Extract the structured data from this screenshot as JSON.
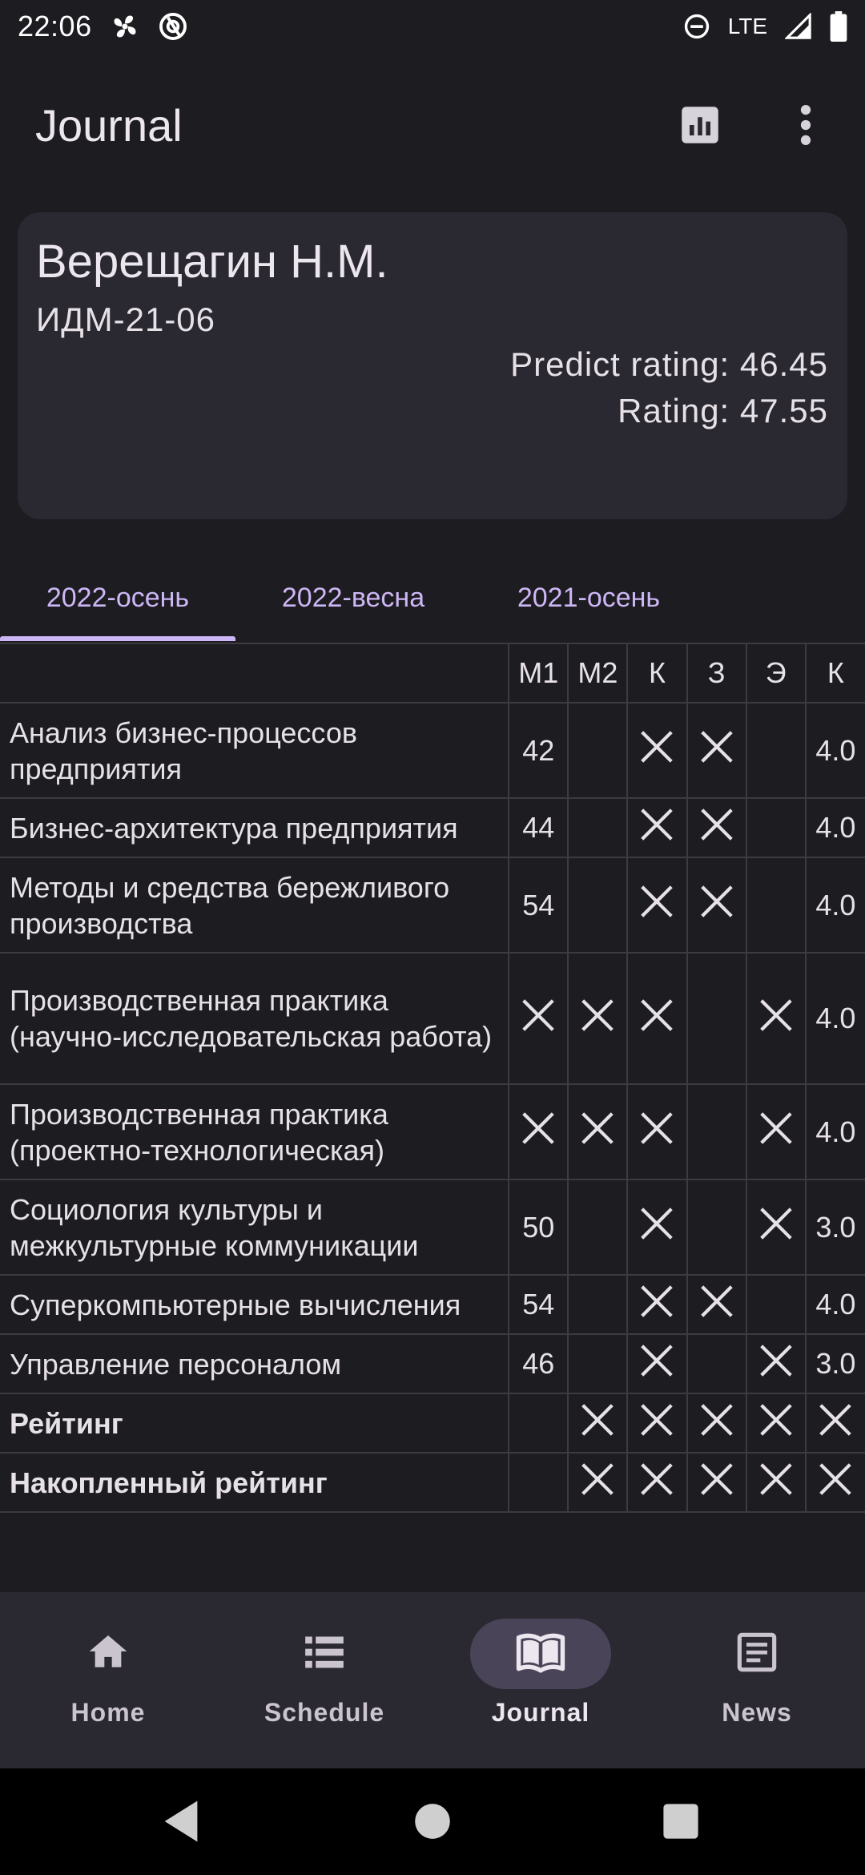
{
  "status_bar": {
    "time": "22:06",
    "network": "LTE",
    "icons": [
      "fan-icon",
      "at-sign-icon",
      "do-not-disturb-icon",
      "signal-icon",
      "battery-icon"
    ]
  },
  "app_bar": {
    "title": "Journal",
    "actions": [
      "bar-chart-icon",
      "more-vert-icon"
    ]
  },
  "profile": {
    "name": "Верещагин Н.М.",
    "group": "ИДМ-21-06",
    "predict_rating": "Predict rating: 46.45",
    "rating": "Rating: 47.55"
  },
  "tabs": [
    {
      "label": "2022-осень",
      "selected": true
    },
    {
      "label": "2022-весна",
      "selected": false
    },
    {
      "label": "2021-осень",
      "selected": false
    }
  ],
  "table": {
    "headers": [
      "",
      "М1",
      "М2",
      "К",
      "З",
      "Э",
      "К"
    ],
    "rows": [
      {
        "subject": "Анализ бизнес-процессов предприятия",
        "bold": false,
        "cells": [
          "42",
          "",
          "x",
          "x",
          "",
          "4.0"
        ]
      },
      {
        "subject": "Бизнес-архитектура предприятия",
        "bold": false,
        "cells": [
          "44",
          "",
          "x",
          "x",
          "",
          "4.0"
        ]
      },
      {
        "subject": "Методы и средства бережливого производства",
        "bold": false,
        "cells": [
          "54",
          "",
          "x",
          "x",
          "",
          "4.0"
        ]
      },
      {
        "subject": "Производственная практика (научно-исследовательская работа)",
        "bold": false,
        "cells": [
          "x",
          "x",
          "x",
          "",
          "x",
          "4.0"
        ]
      },
      {
        "subject": "Производственная практика (проектно-технологическая)",
        "bold": false,
        "cells": [
          "x",
          "x",
          "x",
          "",
          "x",
          "4.0"
        ]
      },
      {
        "subject": "Социология культуры и межкультурные коммуникации",
        "bold": false,
        "cells": [
          "50",
          "",
          "x",
          "",
          "x",
          "3.0"
        ]
      },
      {
        "subject": "Суперкомпьютерные вычисления",
        "bold": false,
        "cells": [
          "54",
          "",
          "x",
          "x",
          "",
          "4.0"
        ]
      },
      {
        "subject": "Управление персоналом",
        "bold": false,
        "cells": [
          "46",
          "",
          "x",
          "",
          "x",
          "3.0"
        ]
      },
      {
        "subject": "Рейтинг",
        "bold": true,
        "cells": [
          "",
          "x",
          "x",
          "x",
          "x",
          "x"
        ]
      },
      {
        "subject": "Накопленный рейтинг",
        "bold": true,
        "cells": [
          "",
          "x",
          "x",
          "x",
          "x",
          "x"
        ]
      }
    ]
  },
  "bottom_nav": [
    {
      "label": "Home",
      "icon": "home-icon",
      "active": false
    },
    {
      "label": "Schedule",
      "icon": "list-icon",
      "active": false
    },
    {
      "label": "Journal",
      "icon": "book-icon",
      "active": true
    },
    {
      "label": "News",
      "icon": "article-icon",
      "active": false
    }
  ],
  "system_nav": [
    "back-icon",
    "home-circle-icon",
    "recents-icon"
  ],
  "colors": {
    "background": "#1d1c21",
    "card": "#2a2830",
    "accent": "#cdb6f5",
    "active_pill": "#4a4458"
  }
}
